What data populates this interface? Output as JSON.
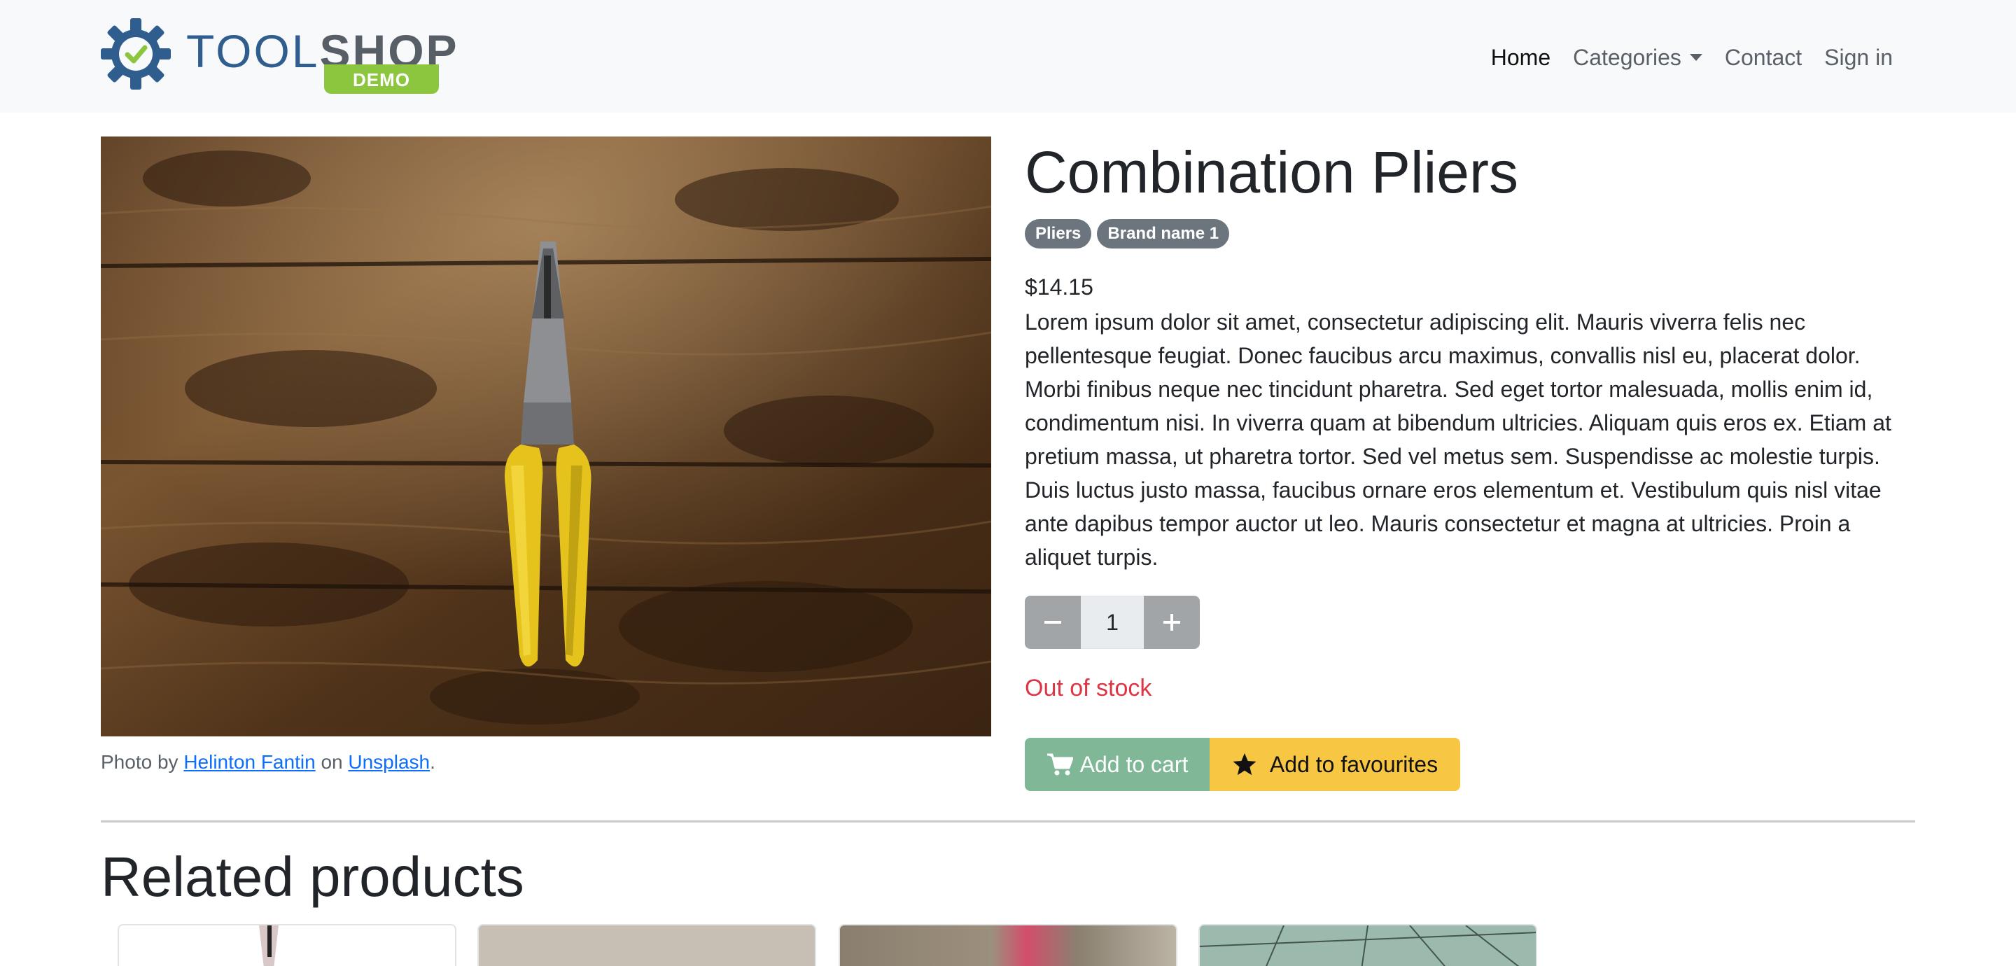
{
  "header": {
    "logo": {
      "word_light": "TOOL",
      "word_bold": "SHOP",
      "tag": "DEMO"
    },
    "nav": [
      {
        "label": "Home",
        "active": true
      },
      {
        "label": "Categories",
        "dropdown": true
      },
      {
        "label": "Contact"
      },
      {
        "label": "Sign in"
      }
    ]
  },
  "product": {
    "title": "Combination Pliers",
    "badges": [
      "Pliers",
      "Brand name 1"
    ],
    "price": "$14.15",
    "description": "Lorem ipsum dolor sit amet, consectetur adipiscing elit. Mauris viverra felis nec pellentesque feugiat. Donec faucibus arcu maximus, convallis nisl eu, placerat dolor. Morbi finibus neque nec tincidunt pharetra. Sed eget tortor malesuada, mollis enim id, condimentum nisi. In viverra quam at bibendum ultricies. Aliquam quis eros ex. Etiam at pretium massa, ut pharetra tortor. Sed vel metus sem. Suspendisse ac molestie turpis. Duis luctus justo massa, faucibus ornare eros elementum et. Vestibulum quis nisl vitae ante dapibus tempor auctor ut leo. Mauris consectetur et magna at ultricies. Proin a aliquet turpis.",
    "quantity": "1",
    "stock_status": "Out of stock",
    "add_to_cart_label": "Add to cart",
    "add_to_favourites_label": "Add to favourites",
    "photo_credit": {
      "prefix": "Photo by",
      "author": "Helinton Fantin",
      "middle": "on",
      "site": "Unsplash",
      "suffix": "."
    }
  },
  "related": {
    "title": "Related products",
    "count_visible": 4
  },
  "colors": {
    "brand_blue": "#2f5d8e",
    "demo_green": "#8cc63e",
    "cart_button": "#7fb797",
    "favourites_button": "#f7c744",
    "out_of_stock": "#dc3545",
    "badge": "#6c757d"
  },
  "icons": {
    "logo": "gear-check-icon",
    "cart": "cart-icon",
    "favourite": "star-icon",
    "decrease": "minus-icon",
    "increase": "plus-icon",
    "dropdown": "caret-down-icon"
  }
}
